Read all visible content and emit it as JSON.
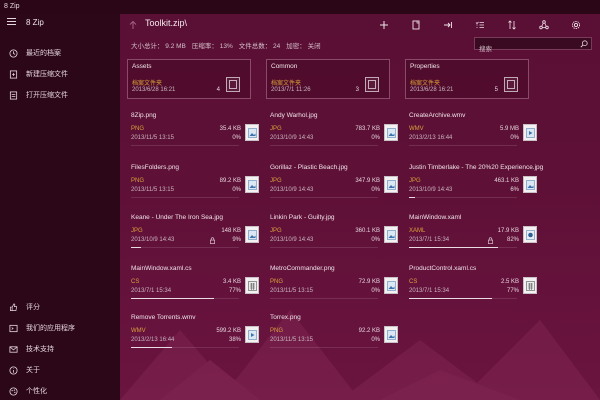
{
  "window": {
    "title": "8 Zip"
  },
  "sidebar": {
    "app_name": "8 Zip",
    "top_items": [
      {
        "label": "最近的档案",
        "icon": "clock-icon"
      },
      {
        "label": "新建压缩文件",
        "icon": "new-archive-icon"
      },
      {
        "label": "打开压缩文件",
        "icon": "open-archive-icon"
      }
    ],
    "bottom_items": [
      {
        "label": "评分",
        "icon": "thumbs-up-icon"
      },
      {
        "label": "我们的应用程序",
        "icon": "apps-icon"
      },
      {
        "label": "技术支持",
        "icon": "mail-icon"
      },
      {
        "label": "关于",
        "icon": "info-icon"
      },
      {
        "label": "个性化",
        "icon": "personalize-icon"
      }
    ]
  },
  "header": {
    "path": "Toolkit.zip\\",
    "stats": [
      "大小总计： 9.2 MB",
      "压缩率： 13%",
      "文件总数： 24",
      "加密： 关闭"
    ]
  },
  "toolbar": {
    "icons": [
      "add-icon",
      "new-file-icon",
      "extract-icon",
      "select-all-icon",
      "sort-icon",
      "share-icon",
      "settings-icon"
    ]
  },
  "search": {
    "placeholder": "搜索",
    "value": ""
  },
  "folders": [
    {
      "name": "Assets",
      "type": "档案文件夹",
      "date": "2013/6/28 16:21",
      "count": "4"
    },
    {
      "name": "Common",
      "type": "档案文件夹",
      "date": "2013/7/1 11:26",
      "count": "3"
    },
    {
      "name": "Properties",
      "type": "档案文件夹",
      "date": "2013/6/28 16:21",
      "count": "5"
    }
  ],
  "files": [
    {
      "name": "8Zip.png",
      "type": "PNG",
      "date": "2013/11/5 13:15",
      "size": "35.4 KB",
      "pct": "0%",
      "fill": 0,
      "icon": "image-file-icon",
      "locked": false
    },
    {
      "name": "Andy Warhol.jpg",
      "type": "JPG",
      "date": "2013/10/9 14:43",
      "size": "783.7 KB",
      "pct": "0%",
      "fill": 0,
      "icon": "image-file-icon",
      "locked": false
    },
    {
      "name": "CreateArchive.wmv",
      "type": "WMV",
      "date": "2013/2/13 16:44",
      "size": "5.9 MB",
      "pct": "0%",
      "fill": 0,
      "icon": "video-file-icon",
      "locked": false
    },
    {
      "name": "FilesFolders.png",
      "type": "PNG",
      "date": "2013/11/5 13:15",
      "size": "89.2 KB",
      "pct": "0%",
      "fill": 0,
      "icon": "image-file-icon",
      "locked": false
    },
    {
      "name": "Gorillaz - Plastic Beach.jpg",
      "type": "JPG",
      "date": "2013/10/9 14:43",
      "size": "347.9 KB",
      "pct": "0%",
      "fill": 0,
      "icon": "image-file-icon",
      "locked": false
    },
    {
      "name": "Justin Timberlake - The 20%20 Experience.jpg",
      "type": "JPG",
      "date": "2013/10/9 14:43",
      "size": "463.1 KB",
      "pct": "6%",
      "fill": 0.06,
      "icon": "image-file-icon",
      "locked": false
    },
    {
      "name": "Keane - Under The Iron Sea.jpg",
      "type": "JPG",
      "date": "2013/10/9 14:43",
      "size": "148 KB",
      "pct": "9%",
      "fill": 0.09,
      "icon": "image-file-icon",
      "locked": true
    },
    {
      "name": "Linkin Park - Guilty.jpg",
      "type": "JPG",
      "date": "2013/10/9 14:43",
      "size": "360.1 KB",
      "pct": "0%",
      "fill": 0,
      "icon": "image-file-icon",
      "locked": false
    },
    {
      "name": "MainWindow.xaml",
      "type": "XAML",
      "date": "2013/7/1 15:34",
      "size": "17.9 KB",
      "pct": "82%",
      "fill": 0.82,
      "icon": "xaml-file-icon",
      "locked": true
    },
    {
      "name": "MainWindow.xaml.cs",
      "type": "CS",
      "date": "2013/7/1 15:34",
      "size": "3.4 KB",
      "pct": "77%",
      "fill": 0.77,
      "icon": "code-file-icon",
      "locked": false
    },
    {
      "name": "MetroCommander.png",
      "type": "PNG",
      "date": "2013/11/5 13:15",
      "size": "72.9 KB",
      "pct": "0%",
      "fill": 0,
      "icon": "image-file-icon",
      "locked": false
    },
    {
      "name": "ProductControl.xaml.cs",
      "type": "CS",
      "date": "2013/7/1 15:34",
      "size": "2.5 KB",
      "pct": "77%",
      "fill": 0.77,
      "icon": "code-file-icon",
      "locked": false
    },
    {
      "name": "Remove Torrents.wmv",
      "type": "WMV",
      "date": "2013/2/13 16:44",
      "size": "599.2 KB",
      "pct": "38%",
      "fill": 0.38,
      "icon": "video-file-icon",
      "locked": false
    },
    {
      "name": "Torrex.png",
      "type": "PNG",
      "date": "2013/11/5 13:15",
      "size": "92.2 KB",
      "pct": "0%",
      "fill": 0,
      "icon": "image-file-icon",
      "locked": false
    }
  ],
  "colors": {
    "accent": "#5a0f34",
    "sidebar": "#2b0718",
    "type_label": "#d8a23a"
  }
}
